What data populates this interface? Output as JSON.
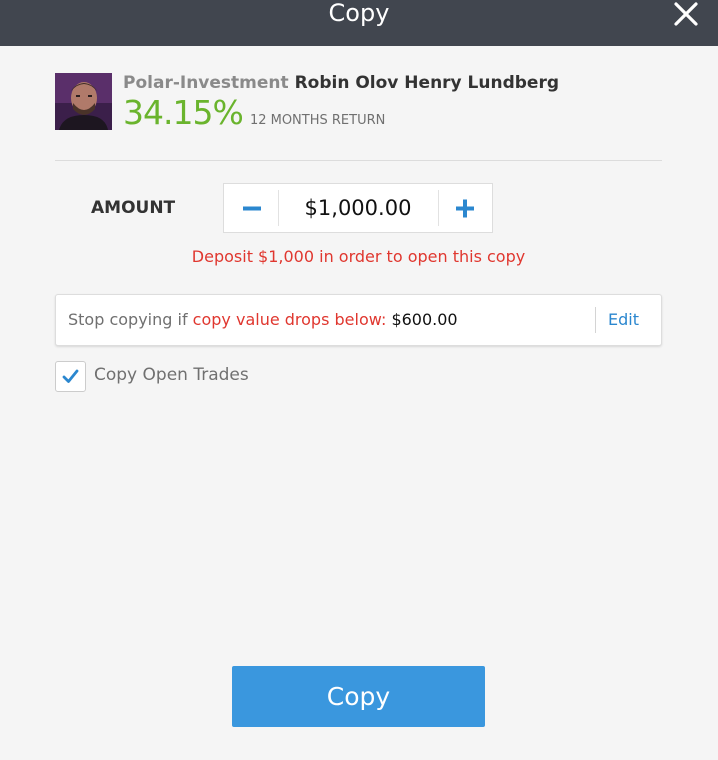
{
  "header": {
    "title": "Copy"
  },
  "trader": {
    "username": "Polar-Investment",
    "full_name": "Robin Olov Henry Lundberg",
    "return_value": "34.15%",
    "return_label": "12 MONTHS RETURN"
  },
  "amount": {
    "label": "AMOUNT",
    "value": "$1,000.00"
  },
  "deposit_message": "Deposit $1,000 in order to open this copy",
  "stop_loss": {
    "prefix": "Stop copying if",
    "highlight": "copy value drops below:",
    "amount": "$600.00",
    "edit_label": "Edit"
  },
  "copy_open_trades": {
    "label": "Copy Open Trades",
    "checked": true
  },
  "footer": {
    "copy_button_label": "Copy"
  },
  "colors": {
    "header_bg": "#41464f",
    "return_green": "#6ab42d",
    "alert_red": "#e0372f",
    "link_blue": "#2b87cf",
    "button_blue": "#3a97de"
  },
  "icons": {
    "close": "close-icon",
    "minus": "minus-icon",
    "plus": "plus-icon",
    "check": "checkmark-icon"
  }
}
